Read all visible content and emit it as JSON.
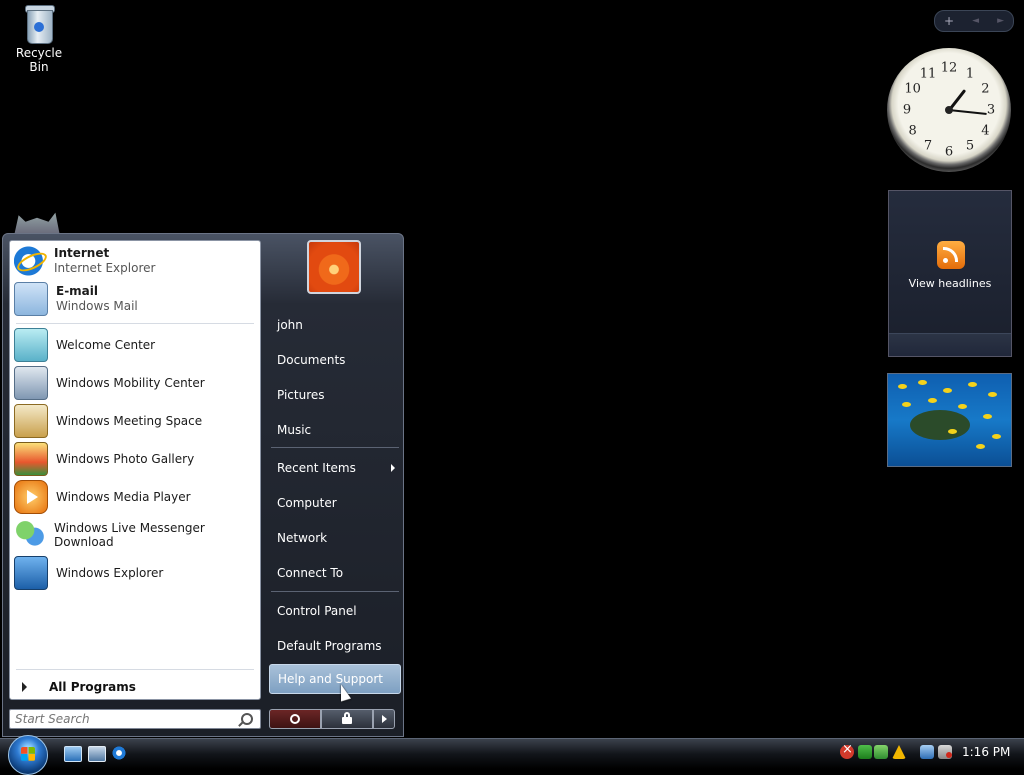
{
  "desktop": {
    "recycle_bin_label": "Recycle Bin"
  },
  "sidebar": {
    "add_gadget": "+",
    "prev": "◄",
    "next": "►",
    "clock_numbers": [
      "12",
      "1",
      "2",
      "3",
      "4",
      "5",
      "6",
      "7",
      "8",
      "9",
      "10",
      "11"
    ],
    "clock_time": {
      "hour": 1,
      "minute": 16
    },
    "feed_label": "View headlines"
  },
  "start_menu": {
    "pinned": [
      {
        "title": "Internet",
        "subtitle": "Internet Explorer",
        "icon": "internet-explorer-icon"
      },
      {
        "title": "E-mail",
        "subtitle": "Windows Mail",
        "icon": "windows-mail-icon"
      }
    ],
    "recent_programs": [
      {
        "label": "Welcome Center",
        "icon": "welcome-center-icon"
      },
      {
        "label": "Windows Mobility Center",
        "icon": "mobility-center-icon"
      },
      {
        "label": "Windows Meeting Space",
        "icon": "meeting-space-icon"
      },
      {
        "label": "Windows Photo Gallery",
        "icon": "photo-gallery-icon"
      },
      {
        "label": "Windows Media Player",
        "icon": "media-player-icon"
      },
      {
        "label": "Windows Live Messenger Download",
        "icon": "messenger-icon"
      },
      {
        "label": "Windows Explorer",
        "icon": "windows-explorer-icon"
      }
    ],
    "all_programs": "All Programs",
    "search_placeholder": "Start Search",
    "right_pane": {
      "user": "john",
      "documents": "Documents",
      "pictures": "Pictures",
      "music": "Music",
      "recent_items": "Recent Items",
      "computer": "Computer",
      "network": "Network",
      "connect_to": "Connect To",
      "control_panel": "Control Panel",
      "default_programs": "Default Programs",
      "help_and_support": "Help and Support"
    }
  },
  "taskbar": {
    "clock": "1:16 PM"
  }
}
